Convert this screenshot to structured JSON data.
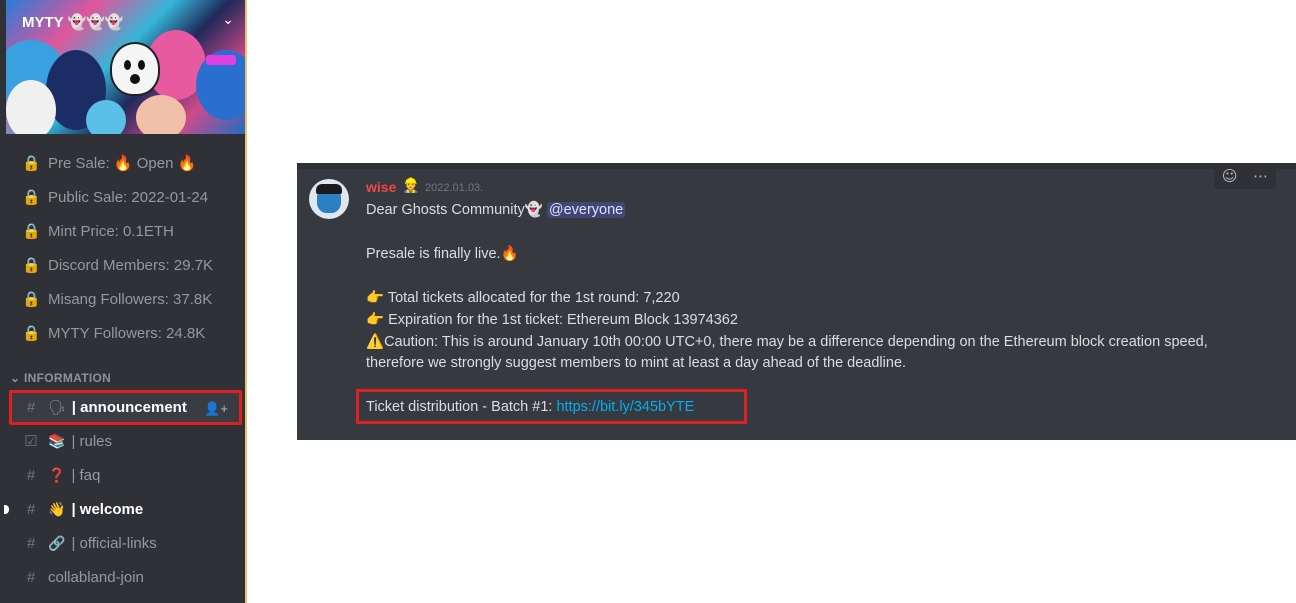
{
  "server": {
    "name": "MYTY 👻👻👻",
    "chevron_icon": "chevron-down-icon"
  },
  "stat_channels": [
    {
      "label": "Pre Sale: 🔥 Open 🔥"
    },
    {
      "label": "Public Sale: 2022-01-24"
    },
    {
      "label": "Mint Price: 0.1ETH"
    },
    {
      "label": "Discord Members: 29.7K"
    },
    {
      "label": "Misang Followers: 37.8K"
    },
    {
      "label": "MYTY Followers: 24.8K"
    }
  ],
  "category": {
    "label": "INFORMATION"
  },
  "channels": [
    {
      "emoji": "🗣",
      "label": "| announcement"
    },
    {
      "emoji": "📚",
      "label": "| rules"
    },
    {
      "emoji": "❓",
      "label": "| faq"
    },
    {
      "emoji": "👋",
      "label": "| welcome"
    },
    {
      "emoji": "🔗",
      "label": "| official-links"
    },
    {
      "emoji": "",
      "label": "collabland-join"
    }
  ],
  "message": {
    "author": "wise",
    "author_emoji": "👷",
    "timestamp": "2022.01.03.",
    "greeting": "Dear Ghosts Community",
    "greeting_emoji": "👻",
    "mention": "@everyone",
    "line_presale": "Presale is finally live.",
    "line_presale_emoji": "🔥",
    "line_tickets": "Total tickets allocated for the 1st round: 7,220",
    "line_expiration": "Expiration for the 1st ticket: Ethereum Block 13974362",
    "line_caution": "Caution: This is around January 10th 00:00 UTC+0, there may be a difference depending on the Ethereum block creation speed,",
    "line_caution2": "therefore we strongly suggest members to mint at least a day ahead of the deadline.",
    "line_batch": "Ticket distribution - Batch #1: ",
    "batch_link": "https://bit.ly/345bYTE",
    "point_emoji": "👉",
    "warn_emoji": "⚠️"
  },
  "toolbar": {
    "reaction_icon": "add-reaction-icon",
    "more_icon": "more-icon"
  },
  "colors": {
    "sidebar_bg": "#2f3136",
    "panel_bg": "#36393f",
    "highlight": "#e02020",
    "author": "#f04747",
    "link": "#00aff4"
  }
}
